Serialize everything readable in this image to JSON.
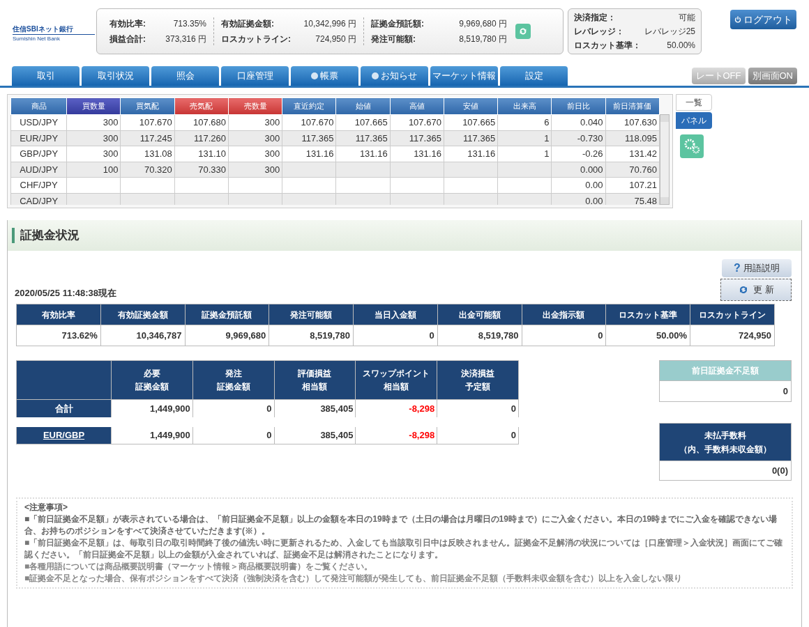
{
  "logo": {
    "name": "住信SBIネット銀行",
    "sub": "Sumishin Net Bank"
  },
  "summary": [
    [
      {
        "label": "有効比率:",
        "value": "713.35%"
      },
      {
        "label": "損益合計:",
        "value": "373,316 円"
      }
    ],
    [
      {
        "label": "有効証拠金額:",
        "value": "10,342,996 円"
      },
      {
        "label": "ロスカットライン:",
        "value": "724,950 円"
      }
    ],
    [
      {
        "label": "証拠金預託額:",
        "value": "9,969,680 円"
      },
      {
        "label": "発注可能額:",
        "value": "8,519,780 円"
      }
    ]
  ],
  "settings": [
    {
      "label": "決済指定：",
      "value": "可能"
    },
    {
      "label": "レバレッジ：",
      "value": "レバレッジ25"
    },
    {
      "label": "ロスカット基準：",
      "value": "50.00%"
    }
  ],
  "logout": "ログアウト",
  "nav_tabs": [
    {
      "label": "取引",
      "kind": "plain"
    },
    {
      "label": "取引状況",
      "kind": "plain"
    },
    {
      "label": "照会",
      "kind": "plain"
    },
    {
      "label": "口座管理",
      "kind": "plain"
    },
    {
      "label": "帳票",
      "kind": "bullet"
    },
    {
      "label": "お知らせ",
      "kind": "bullet"
    },
    {
      "label": "マーケット情報",
      "kind": "plain"
    },
    {
      "label": "設定",
      "kind": "plain"
    }
  ],
  "toggles": [
    {
      "label": "レートOFF",
      "on": false
    },
    {
      "label": "別画面ON",
      "on": true
    }
  ],
  "rate_table": {
    "columns": [
      {
        "label": "商品",
        "kind": "normal"
      },
      {
        "label": "買数量",
        "kind": "buy"
      },
      {
        "label": "買気配",
        "kind": "normal"
      },
      {
        "label": "売気配",
        "kind": "sell"
      },
      {
        "label": "売数量",
        "kind": "sell"
      },
      {
        "label": "直近約定",
        "kind": "normal"
      },
      {
        "label": "始値",
        "kind": "normal"
      },
      {
        "label": "高値",
        "kind": "normal"
      },
      {
        "label": "安値",
        "kind": "normal"
      },
      {
        "label": "出来高",
        "kind": "normal"
      },
      {
        "label": "前日比",
        "kind": "normal"
      },
      {
        "label": "前日清算価",
        "kind": "normal"
      }
    ],
    "rows": [
      [
        "USD/JPY",
        "300",
        "107.670",
        "107.680",
        "300",
        "107.670",
        "107.665",
        "107.670",
        "107.665",
        "6",
        "0.040",
        "107.630"
      ],
      [
        "EUR/JPY",
        "300",
        "117.245",
        "117.260",
        "300",
        "117.365",
        "117.365",
        "117.365",
        "117.365",
        "1",
        "-0.730",
        "118.095"
      ],
      [
        "GBP/JPY",
        "300",
        "131.08",
        "131.10",
        "300",
        "131.16",
        "131.16",
        "131.16",
        "131.16",
        "1",
        "-0.26",
        "131.42"
      ],
      [
        "AUD/JPY",
        "100",
        "70.320",
        "70.330",
        "300",
        "",
        "",
        "",
        "",
        "",
        "0.000",
        "70.760"
      ],
      [
        "CHF/JPY",
        "",
        "",
        "",
        "",
        "",
        "",
        "",
        "",
        "",
        "0.00",
        "107.21"
      ],
      [
        "CAD/JPY",
        "",
        "",
        "",
        "",
        "",
        "",
        "",
        "",
        "",
        "0.00",
        "75.48"
      ]
    ]
  },
  "view_tabs": [
    {
      "label": "一覧",
      "selected": false
    },
    {
      "label": "パネル",
      "selected": true
    }
  ],
  "section": {
    "title": "証拠金状況",
    "help_button": "用語説明",
    "help_icon": "?",
    "refresh_button": "更 新",
    "timestamp": "2020/05/25 11:48:38現在",
    "status_table": {
      "columns": [
        "有効比率",
        "有効証拠金額",
        "証拠金預託額",
        "発注可能額",
        "当日入金額",
        "出金可能額",
        "出金指示額",
        "ロスカット基準",
        "ロスカットライン"
      ],
      "values": [
        "713.62%",
        "10,346,787",
        "9,969,680",
        "8,519,780",
        "0",
        "8,519,780",
        "0",
        "50.00%",
        "724,950"
      ]
    },
    "position_table": {
      "columns": [
        [
          "必要",
          "証拠金額"
        ],
        [
          "発注",
          "証拠金額"
        ],
        [
          "評価損益",
          "相当額"
        ],
        [
          "スワップポイント",
          "相当額"
        ],
        [
          "決済損益",
          "予定額"
        ]
      ],
      "rows": [
        {
          "label": "合計",
          "link": false,
          "values": [
            {
              "text": "1,449,900",
              "negative": false
            },
            {
              "text": "0",
              "negative": false
            },
            {
              "text": "385,405",
              "negative": false
            },
            {
              "text": "-8,298",
              "negative": true
            },
            {
              "text": "0",
              "negative": false
            }
          ]
        },
        {
          "label": "EUR/GBP",
          "link": true,
          "values": [
            {
              "text": "1,449,900",
              "negative": false
            },
            {
              "text": "0",
              "negative": false
            },
            {
              "text": "385,405",
              "negative": false
            },
            {
              "text": "-8,298",
              "negative": true
            },
            {
              "text": "0",
              "negative": false
            }
          ]
        }
      ]
    },
    "shortfall": {
      "title": "前日証拠金不足額",
      "value": "0"
    },
    "unpaid": {
      "title": [
        "未払手数料",
        "（内、手数料未収金額）"
      ],
      "value": "0(0)"
    },
    "notes": [
      "<注意事項>",
      "■「前日証拠金不足額」が表示されている場合は、「前日証拠金不足額」以上の金額を本日の19時まで（土日の場合は月曜日の19時まで）にご入金ください。本日の19時までにご入金を確認できない場合、お持ちのポジションをすべて決済させていただきます(※）。",
      "■「前日証拠金不足額」は、毎取引日の取引時間終了後の値洗い時に更新されるため、入金しても当該取引日中は反映されません。証拠金不足解消の状況については［口座管理＞入金状況］画面にてご確認ください。「前日証拠金不足額」以上の金額が入金されていれば、証拠金不足は解消されたことになります。",
      "■各種用語については商品概要説明書（マーケット情報＞商品概要説明書）をご覧ください。",
      "■証拠金不足となった場合、保有ポジションをすべて決済（強制決済を含む）して発注可能額が発生しても、前日証拠金不足額（手数料未収金額を含む）以上を入金しない限り"
    ]
  }
}
